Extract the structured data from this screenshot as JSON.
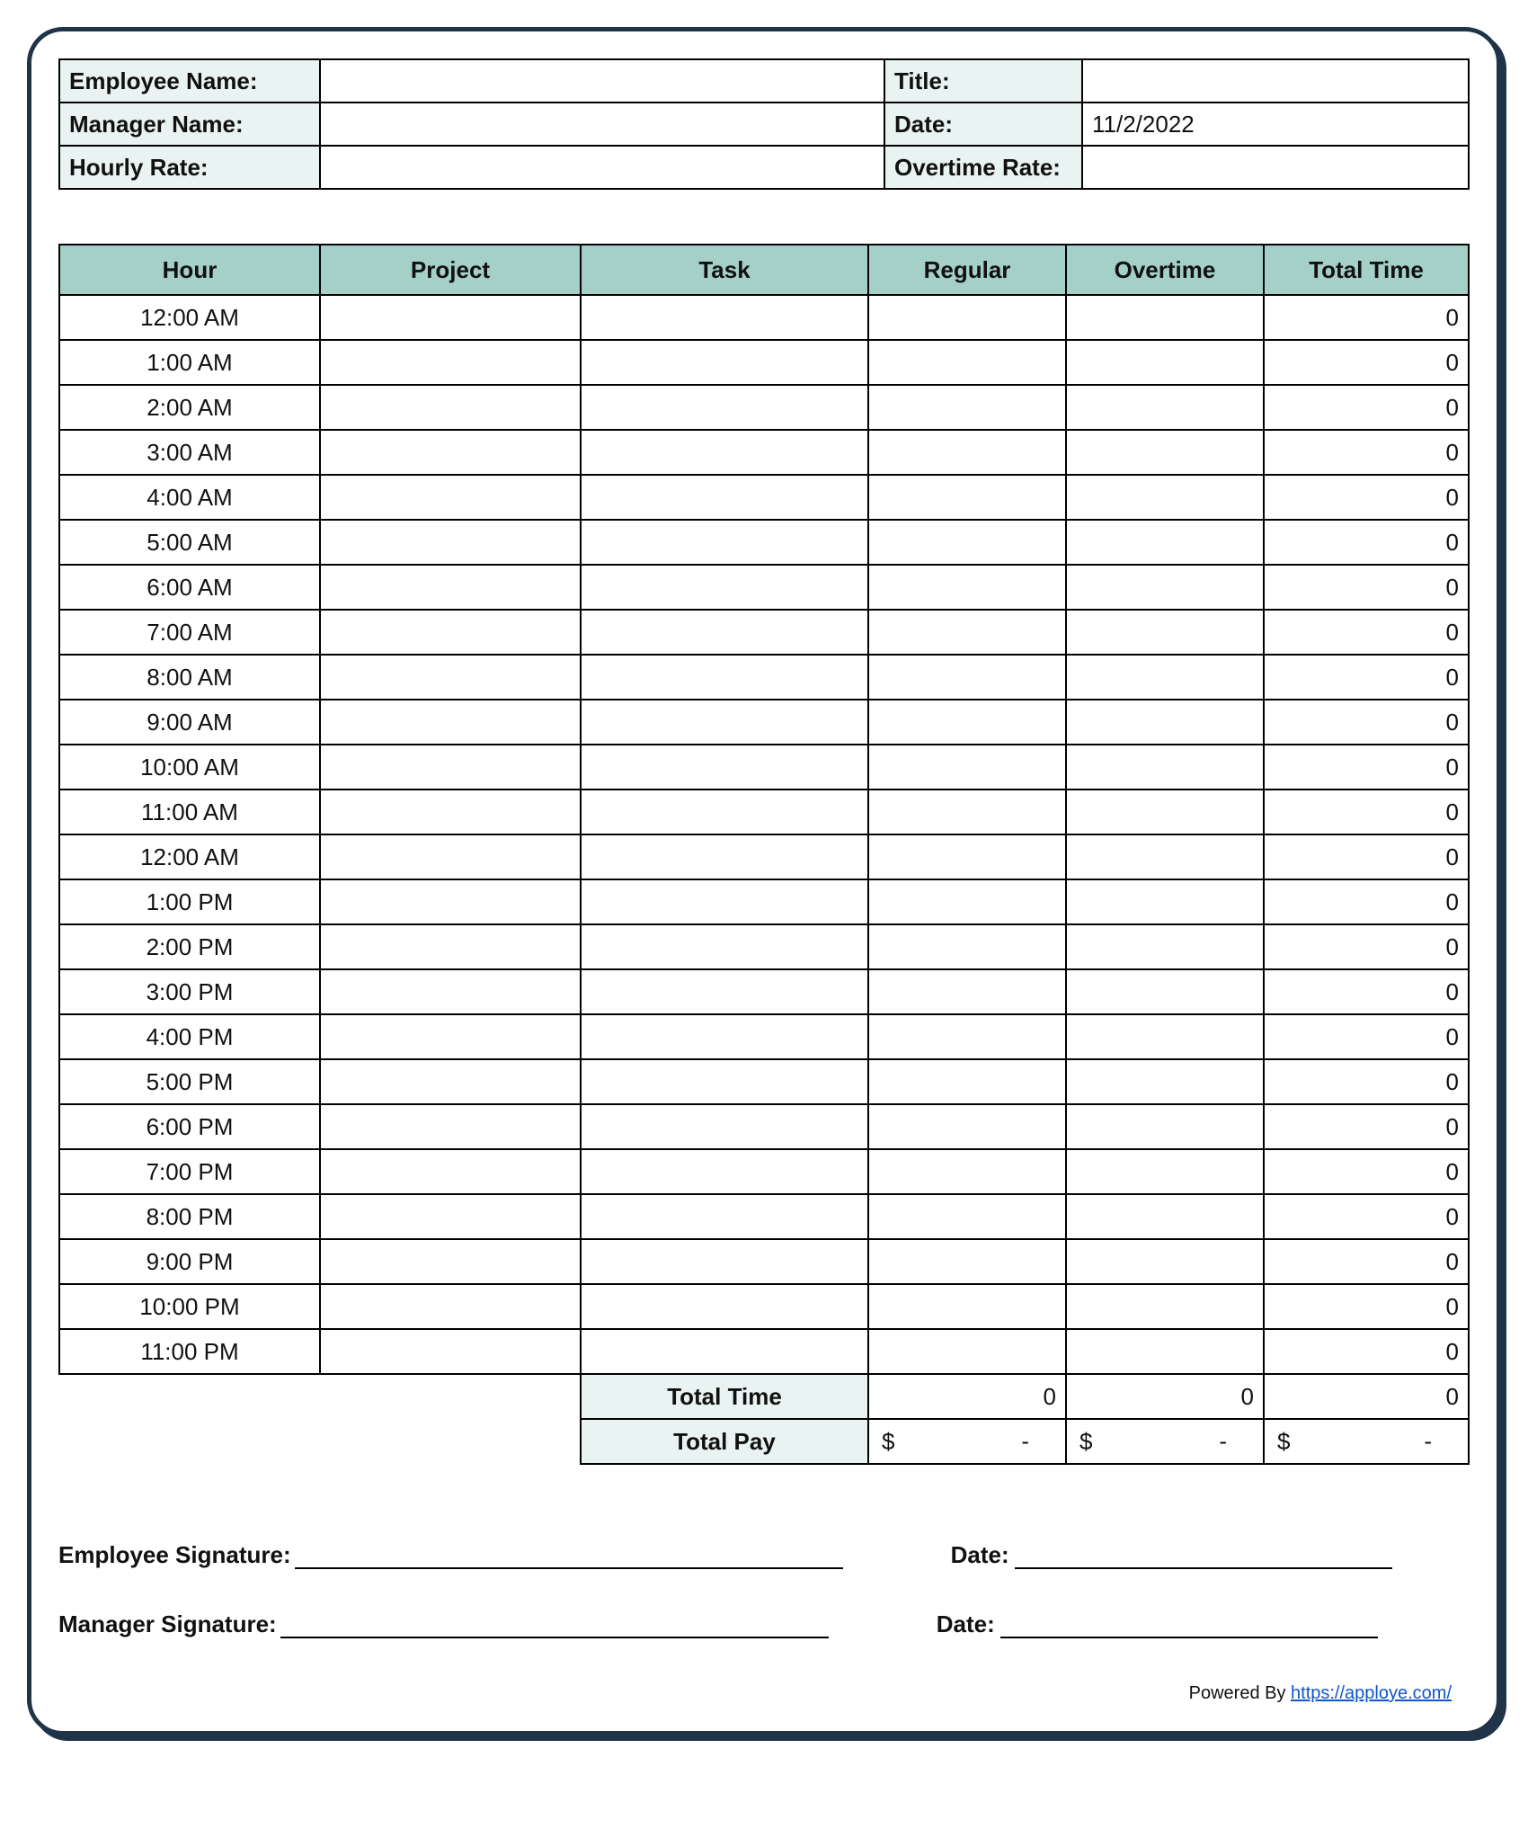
{
  "info": {
    "employee_name_label": "Employee Name:",
    "employee_name_value": "",
    "title_label": "Title:",
    "title_value": "",
    "manager_name_label": "Manager Name:",
    "manager_name_value": "",
    "date_label": "Date:",
    "date_value": "11/2/2022",
    "hourly_rate_label": "Hourly Rate:",
    "hourly_rate_value": "",
    "overtime_rate_label": "Overtime Rate:",
    "overtime_rate_value": ""
  },
  "headers": {
    "hour": "Hour",
    "project": "Project",
    "task": "Task",
    "regular": "Regular",
    "overtime": "Overtime",
    "total_time": "Total Time"
  },
  "rows": [
    {
      "hour": "12:00 AM",
      "project": "",
      "task": "",
      "regular": "",
      "overtime": "",
      "total": "0"
    },
    {
      "hour": "1:00 AM",
      "project": "",
      "task": "",
      "regular": "",
      "overtime": "",
      "total": "0"
    },
    {
      "hour": "2:00 AM",
      "project": "",
      "task": "",
      "regular": "",
      "overtime": "",
      "total": "0"
    },
    {
      "hour": "3:00 AM",
      "project": "",
      "task": "",
      "regular": "",
      "overtime": "",
      "total": "0"
    },
    {
      "hour": "4:00 AM",
      "project": "",
      "task": "",
      "regular": "",
      "overtime": "",
      "total": "0"
    },
    {
      "hour": "5:00 AM",
      "project": "",
      "task": "",
      "regular": "",
      "overtime": "",
      "total": "0"
    },
    {
      "hour": "6:00 AM",
      "project": "",
      "task": "",
      "regular": "",
      "overtime": "",
      "total": "0"
    },
    {
      "hour": "7:00 AM",
      "project": "",
      "task": "",
      "regular": "",
      "overtime": "",
      "total": "0"
    },
    {
      "hour": "8:00 AM",
      "project": "",
      "task": "",
      "regular": "",
      "overtime": "",
      "total": "0"
    },
    {
      "hour": "9:00 AM",
      "project": "",
      "task": "",
      "regular": "",
      "overtime": "",
      "total": "0"
    },
    {
      "hour": "10:00 AM",
      "project": "",
      "task": "",
      "regular": "",
      "overtime": "",
      "total": "0"
    },
    {
      "hour": "11:00 AM",
      "project": "",
      "task": "",
      "regular": "",
      "overtime": "",
      "total": "0"
    },
    {
      "hour": "12:00 AM",
      "project": "",
      "task": "",
      "regular": "",
      "overtime": "",
      "total": "0"
    },
    {
      "hour": "1:00 PM",
      "project": "",
      "task": "",
      "regular": "",
      "overtime": "",
      "total": "0"
    },
    {
      "hour": "2:00 PM",
      "project": "",
      "task": "",
      "regular": "",
      "overtime": "",
      "total": "0"
    },
    {
      "hour": "3:00 PM",
      "project": "",
      "task": "",
      "regular": "",
      "overtime": "",
      "total": "0"
    },
    {
      "hour": "4:00 PM",
      "project": "",
      "task": "",
      "regular": "",
      "overtime": "",
      "total": "0"
    },
    {
      "hour": "5:00 PM",
      "project": "",
      "task": "",
      "regular": "",
      "overtime": "",
      "total": "0"
    },
    {
      "hour": "6:00 PM",
      "project": "",
      "task": "",
      "regular": "",
      "overtime": "",
      "total": "0"
    },
    {
      "hour": "7:00 PM",
      "project": "",
      "task": "",
      "regular": "",
      "overtime": "",
      "total": "0"
    },
    {
      "hour": "8:00 PM",
      "project": "",
      "task": "",
      "regular": "",
      "overtime": "",
      "total": "0"
    },
    {
      "hour": "9:00 PM",
      "project": "",
      "task": "",
      "regular": "",
      "overtime": "",
      "total": "0"
    },
    {
      "hour": "10:00 PM",
      "project": "",
      "task": "",
      "regular": "",
      "overtime": "",
      "total": "0"
    },
    {
      "hour": "11:00 PM",
      "project": "",
      "task": "",
      "regular": "",
      "overtime": "",
      "total": "0"
    }
  ],
  "totals": {
    "total_time_label": "Total Time",
    "total_pay_label": "Total Pay",
    "regular_total": "0",
    "overtime_total": "0",
    "time_total": "0",
    "currency": "$",
    "pay_dash": "-"
  },
  "signatures": {
    "employee_sig_label": "Employee Signature:",
    "manager_sig_label": "Manager Signature:",
    "date_label": "Date:"
  },
  "footer": {
    "powered_by": "Powered By ",
    "link_text": "https://apploye.com/"
  }
}
